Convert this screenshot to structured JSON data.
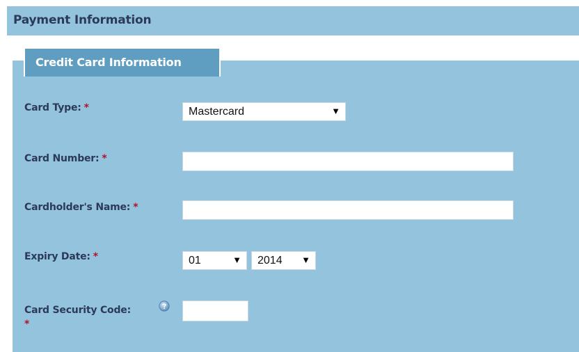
{
  "header": {
    "title": "Payment Information"
  },
  "panel": {
    "tab_label": "Credit Card Information"
  },
  "form": {
    "required_marker": "*",
    "card_type": {
      "label": "Card Type:",
      "value": "Mastercard"
    },
    "card_number": {
      "label": "Card Number:",
      "value": ""
    },
    "cardholder_name": {
      "label": "Cardholder's Name:",
      "value": ""
    },
    "expiry_date": {
      "label": "Expiry Date:",
      "month": "01",
      "year": "2014"
    },
    "security_code": {
      "label": "Card Security Code:",
      "value": "",
      "help_icon": "question-circle-icon"
    }
  },
  "icons": {
    "dropdown": "▼"
  },
  "colors": {
    "panel_background": "#94c3de",
    "tab_background": "#5f9ec0",
    "label_text": "#2b3a59",
    "required": "#b0122b"
  }
}
